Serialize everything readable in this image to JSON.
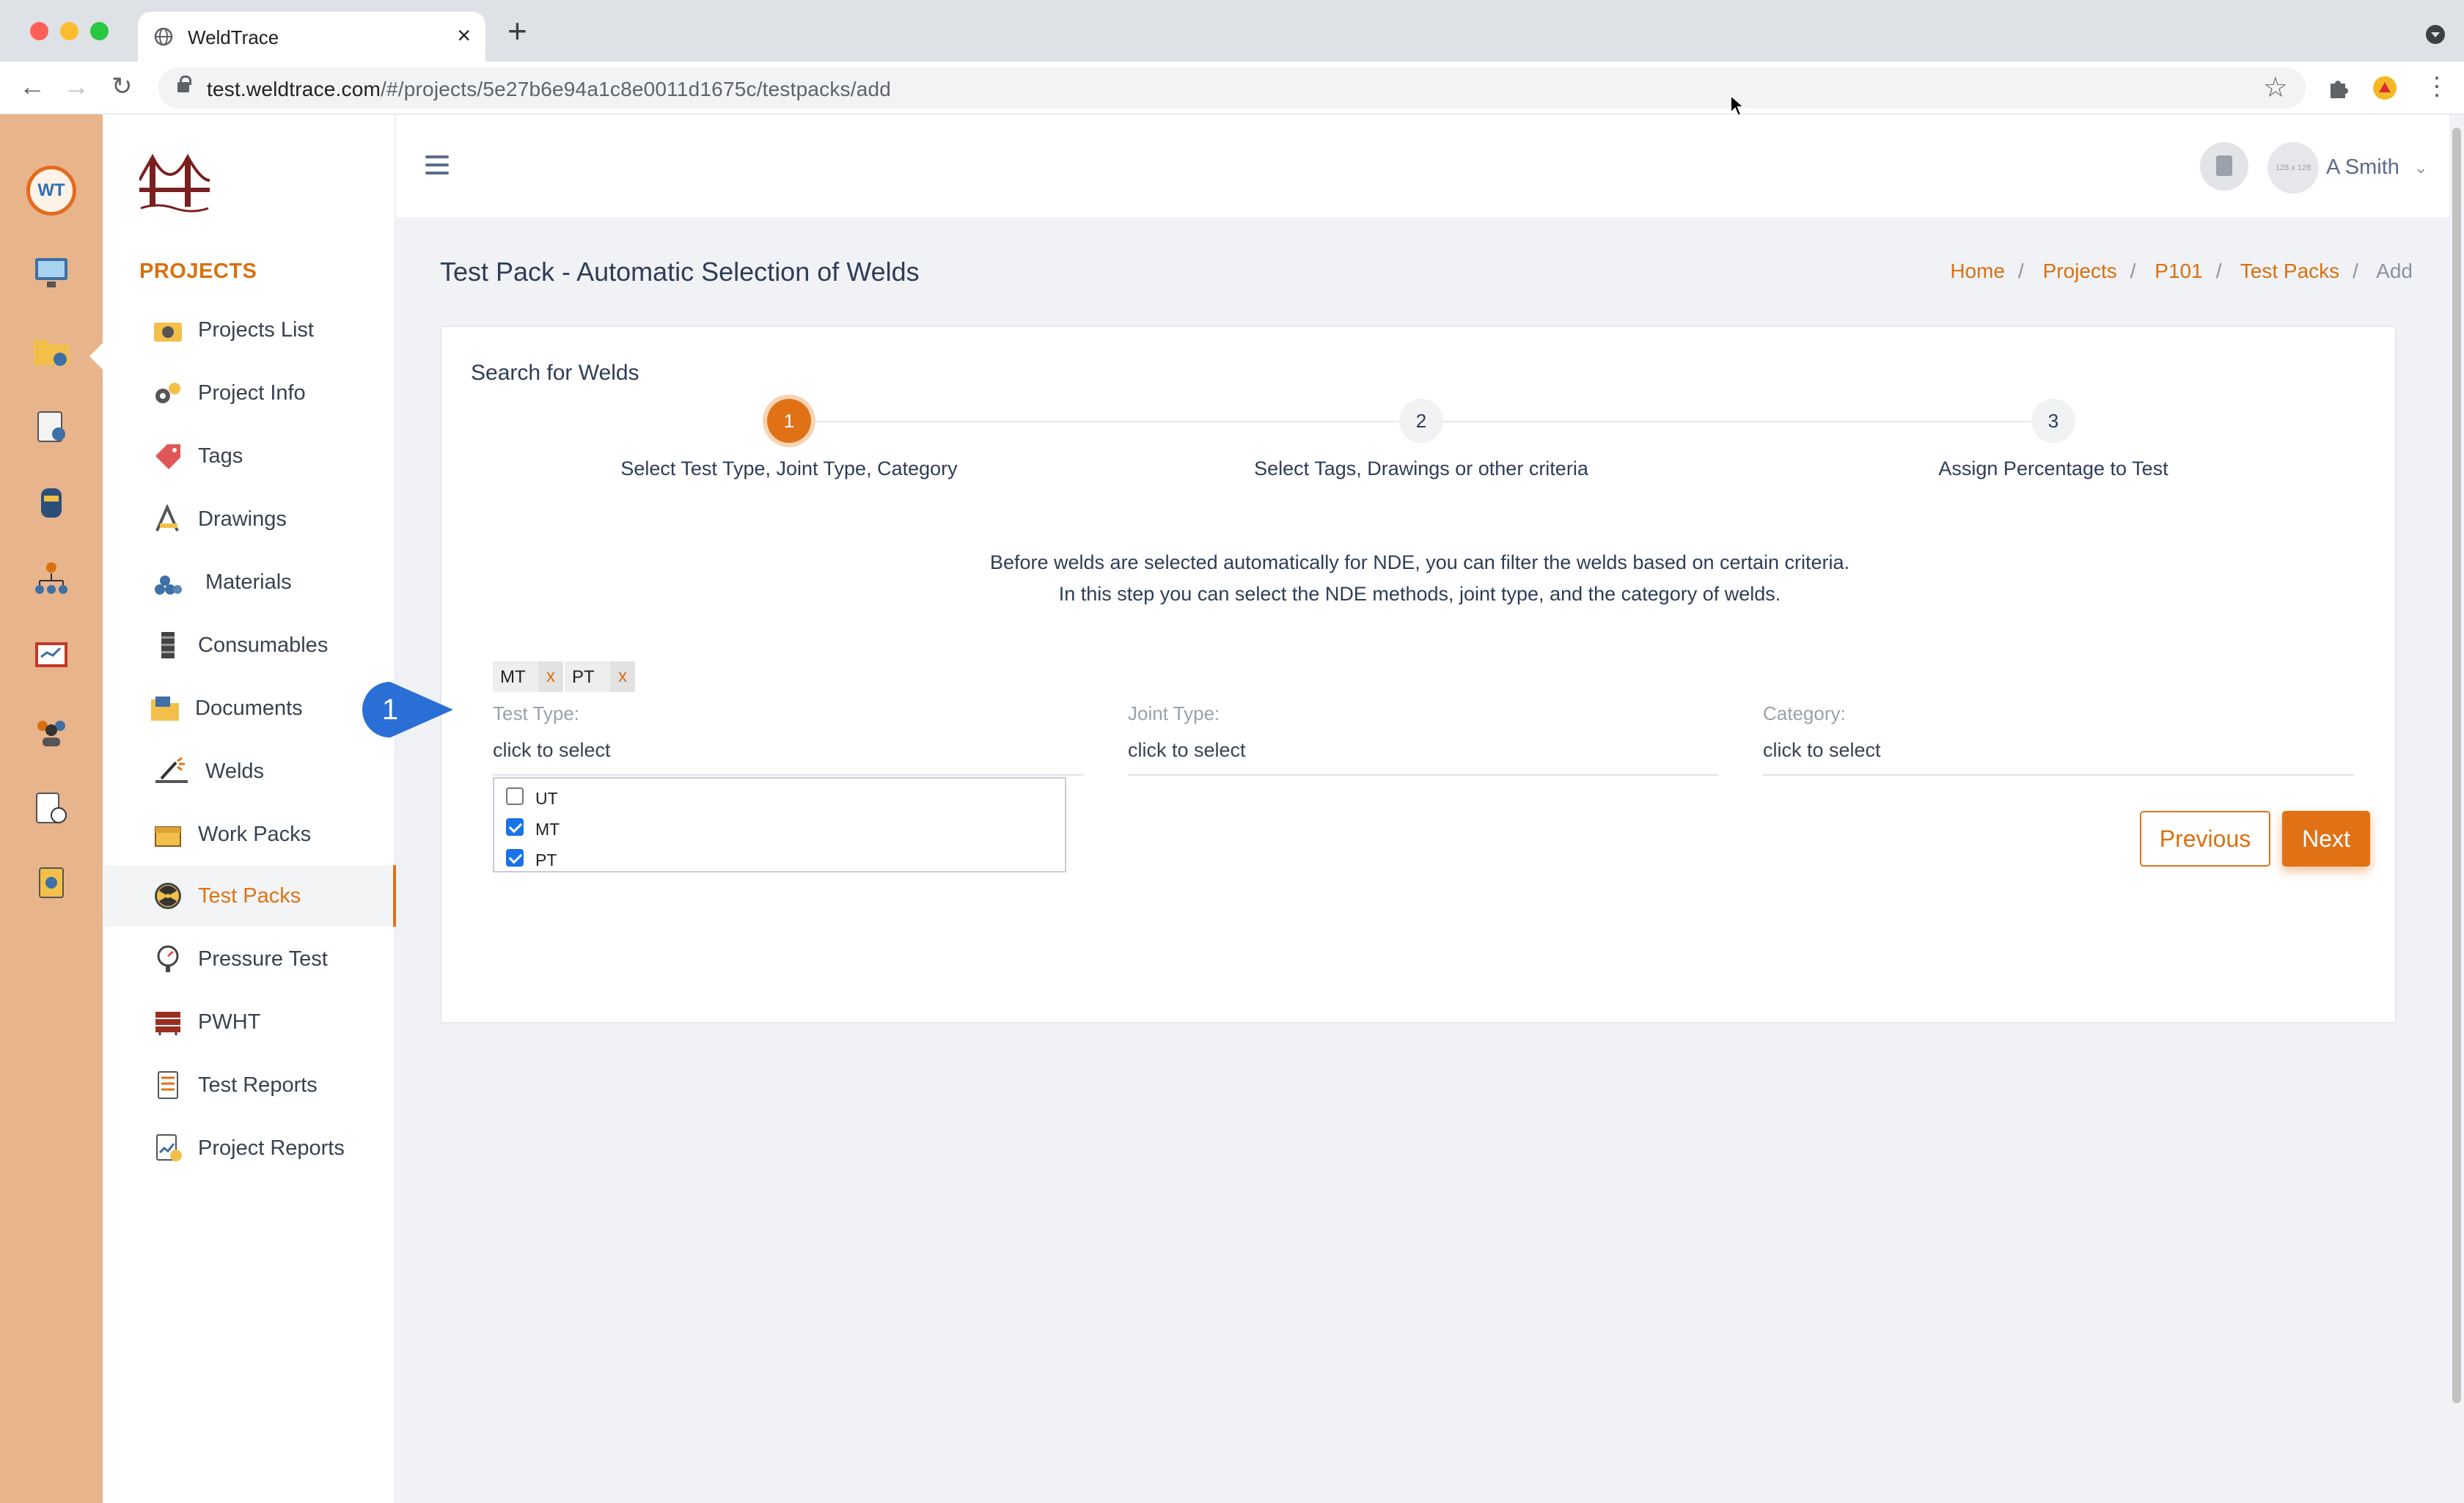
{
  "browser": {
    "tab_title": "WeldTrace",
    "url_host": "test.weldtrace.com",
    "url_path": "/#/projects/5e27b6e94a1c8e0011d1675c/testpacks/add"
  },
  "sidebar": {
    "heading": "PROJECTS",
    "items": [
      {
        "label": "Projects List",
        "icon": "camera-folder-icon"
      },
      {
        "label": "Project Info",
        "icon": "gears-icon"
      },
      {
        "label": "Tags",
        "icon": "tag-icon"
      },
      {
        "label": "Drawings",
        "icon": "drawing-tools-icon"
      },
      {
        "label": "Materials",
        "icon": "pipes-stack-icon"
      },
      {
        "label": "Consumables",
        "icon": "rods-icon"
      },
      {
        "label": "Documents",
        "icon": "folder-icon"
      },
      {
        "label": "Welds",
        "icon": "welding-spark-icon"
      },
      {
        "label": "Work Packs",
        "icon": "package-icon"
      },
      {
        "label": "Test Packs",
        "icon": "radiation-icon",
        "active": true
      },
      {
        "label": "Pressure Test",
        "icon": "gauge-icon"
      },
      {
        "label": "PWHT",
        "icon": "heater-icon"
      },
      {
        "label": "Test Reports",
        "icon": "checklist-icon"
      },
      {
        "label": "Project Reports",
        "icon": "report-icon"
      }
    ]
  },
  "header": {
    "user_name": "A Smith",
    "avatar_text": "128 x 128"
  },
  "page": {
    "title": "Test Pack - Automatic Selection of Welds",
    "breadcrumb": [
      "Home",
      "Projects",
      "P101",
      "Test Packs",
      "Add"
    ]
  },
  "card": {
    "title": "Search for Welds",
    "steps": [
      {
        "number": "1",
        "label": "Select Test Type, Joint Type, Category",
        "active": true
      },
      {
        "number": "2",
        "label": "Select Tags, Drawings or other criteria"
      },
      {
        "number": "3",
        "label": "Assign Percentage to Test"
      }
    ],
    "intro_line1": "Before welds are selected automatically for NDE, you can filter the welds based on certain criteria.",
    "intro_line2": "In this step you can select the NDE methods, joint type, and the category of welds.",
    "selected_chips": [
      {
        "label": "MT",
        "remove": "x"
      },
      {
        "label": "PT",
        "remove": "x"
      }
    ],
    "marker_number": "1",
    "fields": {
      "test_type": {
        "label": "Test Type:",
        "value": "click to select"
      },
      "joint_type": {
        "label": "Joint Type:",
        "value": "click to select"
      },
      "category": {
        "label": "Category:",
        "value": "click to select"
      }
    },
    "test_type_options": [
      {
        "label": "UT",
        "checked": false
      },
      {
        "label": "MT",
        "checked": true
      },
      {
        "label": "PT",
        "checked": true
      }
    ],
    "previous_label": "Previous",
    "next_label": "Next"
  },
  "colors": {
    "accent": "#e07215",
    "rail": "#e8b48b",
    "text_dark": "#2e3d57"
  }
}
